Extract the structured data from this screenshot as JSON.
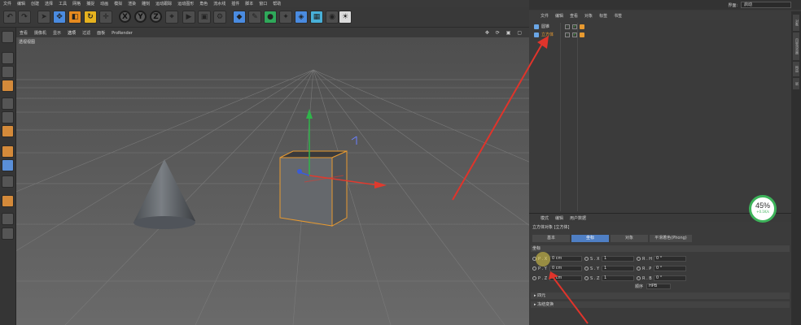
{
  "menubar": {
    "items": [
      "文件",
      "编辑",
      "创建",
      "选择",
      "工具",
      "网格",
      "捕捉",
      "动画",
      "模拟",
      "渲染",
      "雕刻",
      "运动跟踪",
      "运动图形",
      "角色",
      "流水线",
      "插件",
      "脚本",
      "窗口",
      "帮助"
    ]
  },
  "toolbar": {
    "xyz": [
      "X",
      "Y",
      "Z"
    ]
  },
  "viewport": {
    "menu": [
      "查看",
      "摄像机",
      "显示",
      "选项",
      "过滤",
      "面板",
      "ProRender"
    ],
    "active_menu": "选项",
    "label": "透视视图"
  },
  "object_manager": {
    "layout_label": "界面:",
    "layout_value": "启动",
    "menu": [
      "文件",
      "编辑",
      "查看",
      "对象",
      "标签",
      "书签"
    ],
    "objects": [
      {
        "name": "圆锥",
        "selected": false,
        "color": "#6aa6e6"
      },
      {
        "name": "立方体",
        "selected": true,
        "color": "#6aa6e6"
      }
    ]
  },
  "right_strip": [
    "对象",
    "内容浏览器",
    "构造",
    "层"
  ],
  "attribute_manager": {
    "menu": [
      "模式",
      "编辑",
      "用户数据"
    ],
    "title": "立方体对象 [立方体]",
    "tabs": [
      "基本",
      "坐标",
      "对象",
      "平滑着色(Phong)"
    ],
    "active_tab": "坐标",
    "section": "坐标",
    "rows": [
      {
        "p_label": "P . X",
        "p_val": "0 cm",
        "s_label": "S . X",
        "s_val": "1",
        "r_label": "R . H",
        "r_val": "0 °"
      },
      {
        "p_label": "P . Y",
        "p_val": "0 cm",
        "s_label": "S . Y",
        "s_val": "1",
        "r_label": "R . P",
        "r_val": "0 °"
      },
      {
        "p_label": "P . Z",
        "p_val": "0 cm",
        "s_label": "S . Z",
        "s_val": "1",
        "r_label": "R . B",
        "r_val": "0 °"
      }
    ],
    "order_label": "顺序",
    "order_value": "HPB",
    "folds": [
      "▸ 四元",
      "▸ 冻结变换"
    ]
  },
  "progress_badge": {
    "percent": "45%",
    "speed": "+0.1K/s",
    "value": 0.45
  },
  "colors": {
    "accent_tab": "#4f7fc4",
    "selection_orange": "#f0a030",
    "arrow_red": "#e0342b",
    "badge_green": "#3db35a"
  }
}
